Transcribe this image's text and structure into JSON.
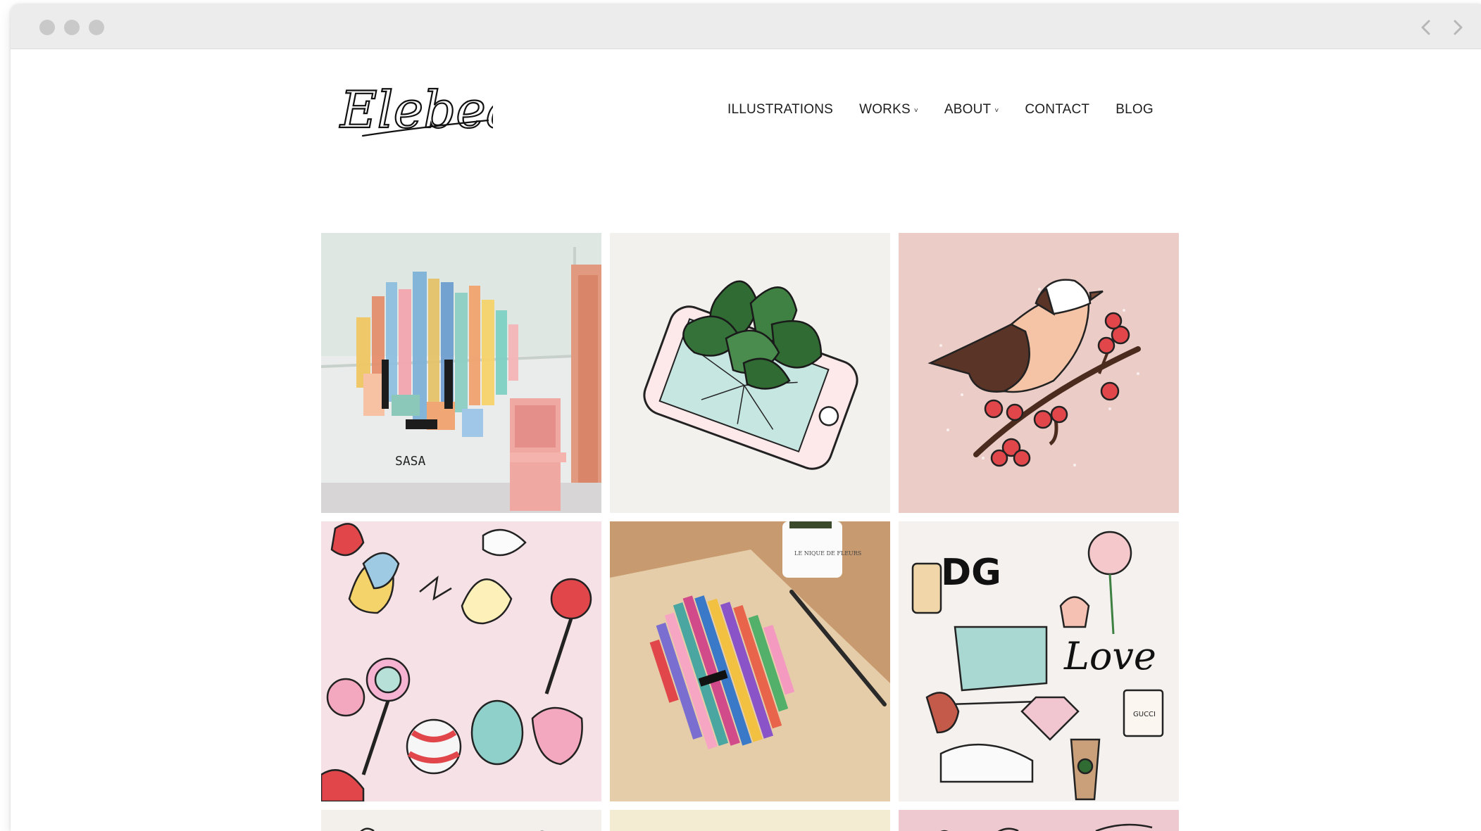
{
  "browser": {
    "back_icon": "chevron-left-icon",
    "forward_icon": "chevron-right-icon"
  },
  "site": {
    "logo_text": "Elebea"
  },
  "nav": {
    "items": [
      {
        "label": "ILLUSTRATIONS",
        "dropdown": false
      },
      {
        "label": "WORKS",
        "dropdown": true
      },
      {
        "label": "ABOUT",
        "dropdown": true
      },
      {
        "label": "CONTACT",
        "dropdown": false
      },
      {
        "label": "BLOG",
        "dropdown": false
      }
    ],
    "caret": "˅"
  },
  "gallery": {
    "tiles": [
      {
        "subject": "mural-wall-pixel-face",
        "background": "#e9ecea"
      },
      {
        "subject": "plant-growing-from-phone",
        "background": "#f3f1ee"
      },
      {
        "subject": "bird-on-berry-branch",
        "background": "#ecccc7"
      },
      {
        "subject": "candy-pattern",
        "background": "#f6e1e6"
      },
      {
        "subject": "painting-on-paper-with-mug",
        "background": "#c89a6f"
      },
      {
        "subject": "fashion-doodles-love",
        "background": "#f4f1ee"
      },
      {
        "subject": "partial-illustration",
        "background": "#f3f0ec"
      },
      {
        "subject": "partial-illustration",
        "background": "#f3ecd2"
      },
      {
        "subject": "partial-illustration",
        "background": "#efc9d0"
      }
    ]
  },
  "artwork_text": {
    "mural_tag": "SASA",
    "love_word": "Love",
    "dg_letters": "DG",
    "mug_text": "LE NIQUE DE FLEURS",
    "perfume_label": "GUCCI"
  }
}
